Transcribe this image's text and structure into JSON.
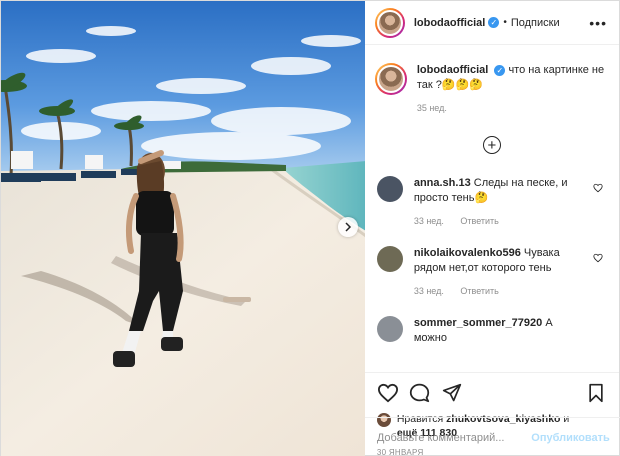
{
  "header": {
    "username": "lobodaofficial",
    "separator": "•",
    "follow_label": "Подписки",
    "more_icon": "more-options-icon"
  },
  "caption": {
    "username": "lobodaofficial",
    "text": "что на картинке не так ?🤔🤔🤔",
    "time": "35 нед."
  },
  "comments": [
    {
      "username": "anna.sh.13",
      "text": "Следы на песке, и просто тень🤔",
      "time": "33 нед.",
      "reply_label": "Ответить",
      "avatar_color": "#4a5463"
    },
    {
      "username": "nikolaikovalenko596",
      "text": "Чувака рядом нет,от которого тень",
      "time": "33 нед.",
      "reply_label": "Ответить",
      "avatar_color": "#6e6a55"
    },
    {
      "username": "sommer_sommer_77920",
      "text": "А можно",
      "avatar_color": "#8a8f96"
    }
  ],
  "likes": {
    "prefix": "Нравится",
    "liker": "zhukovtsova_kiyashko",
    "conj": "и",
    "others": "ещё 111 830"
  },
  "date": "30 ЯНВАРЯ",
  "add_comment": {
    "placeholder": "Добавьте комментарий...",
    "publish_label": "Опубликовать"
  },
  "colors": {
    "verified": "#3897f0",
    "publish": "#b2dffc",
    "meta": "#8e8e8e"
  }
}
